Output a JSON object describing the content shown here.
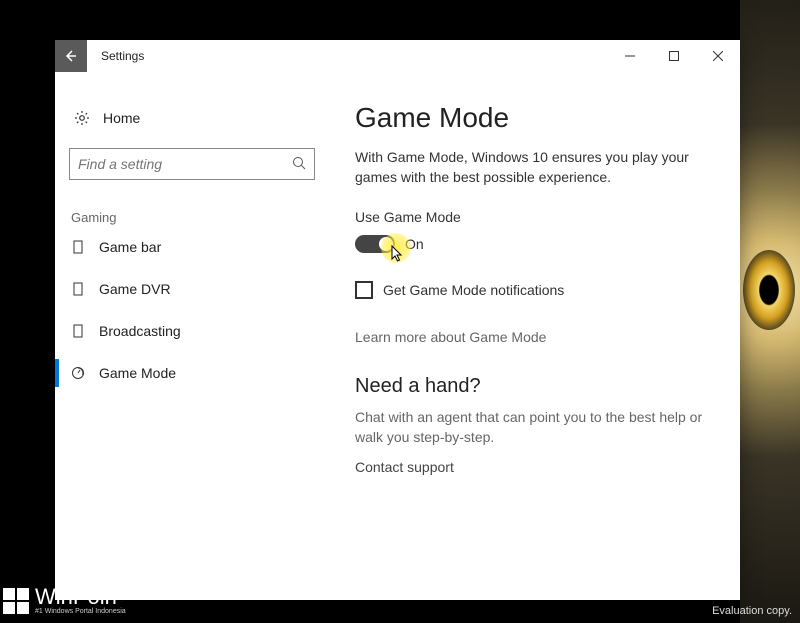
{
  "window": {
    "title": "Settings"
  },
  "sidebar": {
    "home_label": "Home",
    "search_placeholder": "Find a setting",
    "group_header": "Gaming",
    "items": [
      {
        "label": "Game bar"
      },
      {
        "label": "Game DVR"
      },
      {
        "label": "Broadcasting"
      },
      {
        "label": "Game Mode"
      }
    ]
  },
  "main": {
    "heading": "Game Mode",
    "description": "With Game Mode, Windows 10 ensures you play your games with the best possible experience.",
    "toggle_label": "Use Game Mode",
    "toggle_state": "On",
    "checkbox_label": "Get Game Mode notifications",
    "learn_more": "Learn more about Game Mode",
    "help_heading": "Need a hand?",
    "help_desc": "Chat with an agent that can point you to the best help or walk you step-by-step.",
    "help_link": "Contact support"
  },
  "watermark": {
    "brand": "WinPoin",
    "subtitle": "#1 Windows Portal Indonesia"
  },
  "desktop": {
    "eval_text": "Evaluation copy."
  }
}
